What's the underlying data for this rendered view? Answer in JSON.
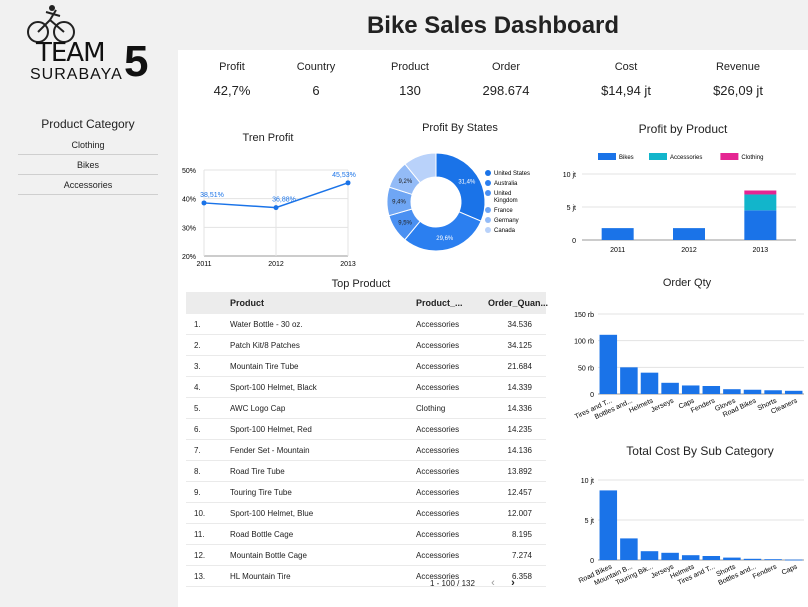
{
  "app": {
    "title": "Bike Sales Dashboard"
  },
  "logo": {
    "team": "TEAM",
    "number": "5",
    "city": "SURABAYA"
  },
  "filter": {
    "title": "Product Category",
    "items": [
      "Clothing",
      "Bikes",
      "Accessories"
    ]
  },
  "kpis": [
    {
      "label": "Profit",
      "value": "42,7%"
    },
    {
      "label": "Country",
      "value": "6"
    },
    {
      "label": "Product",
      "value": "130"
    },
    {
      "label": "Order",
      "value": "298.674"
    },
    {
      "label": "Cost",
      "value": "$14,94 jt"
    },
    {
      "label": "Revenue",
      "value": "$26,09 jt"
    }
  ],
  "colors": {
    "primary": "#1a73e8",
    "accessories": "#12b5cb",
    "clothing": "#e52592",
    "sidebar": "#f1f1f1"
  },
  "table": {
    "title": "Top Product",
    "headers": [
      "Product",
      "Product_...",
      "Order_Quan..."
    ],
    "rows": [
      [
        "1.",
        "Water Bottle - 30 oz.",
        "Accessories",
        "34.536"
      ],
      [
        "2.",
        "Patch Kit/8 Patches",
        "Accessories",
        "34.125"
      ],
      [
        "3.",
        "Mountain Tire Tube",
        "Accessories",
        "21.684"
      ],
      [
        "4.",
        "Sport-100 Helmet, Black",
        "Accessories",
        "14.339"
      ],
      [
        "5.",
        "AWC Logo Cap",
        "Clothing",
        "14.336"
      ],
      [
        "6.",
        "Sport-100 Helmet, Red",
        "Accessories",
        "14.235"
      ],
      [
        "7.",
        "Fender Set - Mountain",
        "Accessories",
        "14.136"
      ],
      [
        "8.",
        "Road Tire Tube",
        "Accessories",
        "13.892"
      ],
      [
        "9.",
        "Touring Tire Tube",
        "Accessories",
        "12.457"
      ],
      [
        "10.",
        "Sport-100 Helmet, Blue",
        "Accessories",
        "12.007"
      ],
      [
        "11.",
        "Road Bottle Cage",
        "Accessories",
        "8.195"
      ],
      [
        "12.",
        "Mountain Bottle Cage",
        "Accessories",
        "7.274"
      ],
      [
        "13.",
        "HL Mountain Tire",
        "Accessories",
        "6.358"
      ]
    ],
    "pagination": "1 - 100 / 132",
    "prev": "‹",
    "next": "›"
  },
  "chart_data": [
    {
      "id": "tren",
      "type": "line",
      "title": "Tren Profit",
      "categories": [
        "2011",
        "2012",
        "2013"
      ],
      "values": [
        38.51,
        36.88,
        45.53
      ],
      "labels": [
        "38,51%",
        "36,88%",
        "45,53%"
      ],
      "yticks": [
        "20%",
        "30%",
        "40%",
        "50%"
      ],
      "ylim": [
        20,
        50
      ]
    },
    {
      "id": "states",
      "type": "pie",
      "title": "Profit By States",
      "slices": [
        {
          "name": "United States",
          "value": 31.4,
          "label": "31,4%",
          "color": "#1a73e8"
        },
        {
          "name": "Australia",
          "value": 29.6,
          "label": "29,6%",
          "color": "#2b7ff0"
        },
        {
          "name": "United Kingdom",
          "value": 9.5,
          "label": "9,5%",
          "color": "#4a90f2"
        },
        {
          "name": "France",
          "value": 9.4,
          "label": "9,4%",
          "color": "#6fa6f4"
        },
        {
          "name": "Germany",
          "value": 9.2,
          "label": "9,2%",
          "color": "#93bbf7"
        },
        {
          "name": "Canada",
          "value": 10.9,
          "label": "",
          "color": "#b9d2fa"
        }
      ]
    },
    {
      "id": "byproduct",
      "type": "bar",
      "title": "Profit by Product",
      "categories": [
        "2011",
        "2012",
        "2013"
      ],
      "series": [
        {
          "name": "Bikes",
          "values": [
            1.8,
            1.8,
            4.5
          ],
          "color": "#1a73e8"
        },
        {
          "name": "Accessories",
          "values": [
            0,
            0,
            2.4
          ],
          "color": "#12b5cb"
        },
        {
          "name": "Clothing",
          "values": [
            0,
            0,
            0.6
          ],
          "color": "#e52592"
        }
      ],
      "yticks": [
        "0",
        "5 jt",
        "10 jt"
      ],
      "ylim": [
        0,
        10
      ]
    },
    {
      "id": "orderqty",
      "type": "bar",
      "title": "Order Qty",
      "categories": [
        "Tires and T...",
        "Bottles and...",
        "Helmets",
        "Jerseys",
        "Caps",
        "Fenders",
        "Gloves",
        "Road Bikes",
        "Shorts",
        "Cleaners"
      ],
      "values": [
        111,
        50,
        40,
        21,
        16,
        15,
        9,
        8,
        7,
        6
      ],
      "yticks": [
        "0",
        "50 rb",
        "100 rb",
        "150 rb"
      ],
      "ylim": [
        0,
        150
      ]
    },
    {
      "id": "cost",
      "type": "bar",
      "title": "Total Cost By Sub Category",
      "categories": [
        "Road Bikes",
        "Mountain B...",
        "Touring Bik...",
        "Jerseys",
        "Helmets",
        "Tires and T...",
        "Shorts",
        "Bottles and...",
        "Fenders",
        "Caps"
      ],
      "values": [
        8.7,
        2.7,
        1.1,
        0.9,
        0.6,
        0.5,
        0.3,
        0.15,
        0.1,
        0.05
      ],
      "yticks": [
        "0",
        "5 jt",
        "10 jt"
      ],
      "ylim": [
        0,
        10
      ]
    }
  ]
}
